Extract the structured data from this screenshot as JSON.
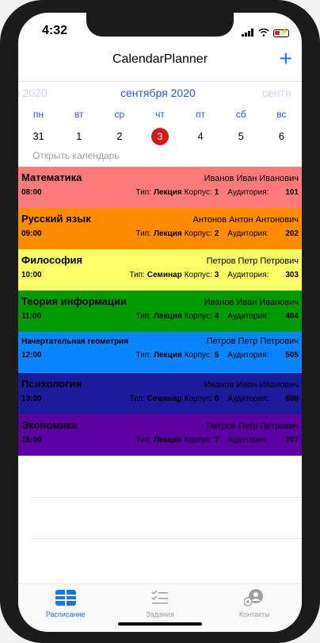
{
  "status_bar": {
    "time": "4:32"
  },
  "navbar": {
    "title": "CalendarPlanner",
    "add_icon": "plus-icon"
  },
  "week": {
    "prev_month": "я 2020",
    "current_month": "сентября 2020",
    "next_month": "сентя",
    "days": [
      {
        "name": "пн",
        "num": "31"
      },
      {
        "name": "вт",
        "num": "1"
      },
      {
        "name": "ср",
        "num": "2"
      },
      {
        "name": "чт",
        "num": "3"
      },
      {
        "name": "пт",
        "num": "4"
      },
      {
        "name": "сб",
        "num": "5"
      },
      {
        "name": "вс",
        "num": "6"
      }
    ]
  },
  "open_calendar": "Открыть календарь",
  "labels": {
    "type": "Тип:",
    "building": "Корпус:",
    "room": "Аудитория:"
  },
  "lessons": [
    {
      "subject": "Математика",
      "teacher": "Иванов Иван Иванович",
      "time": "08:00",
      "type": "Лекция",
      "building": "1",
      "room": "101",
      "color": "#ff7b7b"
    },
    {
      "subject": "Русский язык",
      "teacher": "Антонов Антон Антонович",
      "time": "09:00",
      "type": "Лекция",
      "building": "2",
      "room": "202",
      "color": "#ff8c00"
    },
    {
      "subject": "Философия",
      "teacher": "Петров Петр Петрович",
      "time": "10:00",
      "type": "Семинар",
      "building": "3",
      "room": "303",
      "color": "#ffff66"
    },
    {
      "subject": "Теория информации",
      "teacher": "Иванов Иван Иванович",
      "time": "11:00",
      "type": "Лекция",
      "building": "4",
      "room": "404",
      "color": "#009900"
    },
    {
      "subject": "Начертательная геометрия",
      "teacher": "Петров Петр Петрович",
      "time": "12:00",
      "type": "Лекция",
      "building": "5",
      "room": "505",
      "color": "#0a84ff"
    },
    {
      "subject": "Психология",
      "teacher": "Иванов Иван Иванович",
      "time": "13:00",
      "type": "Семинар",
      "building": "6",
      "room": "606",
      "color": "#1a1a9a"
    },
    {
      "subject": "Экономика",
      "teacher": "Петров Петр Петрович",
      "time": "15:00",
      "type": "Лекция",
      "building": "7",
      "room": "707",
      "color": "#5c00a3"
    }
  ],
  "tabs": [
    {
      "label": "Расписание",
      "icon": "grid-icon",
      "active": true
    },
    {
      "label": "Задания",
      "icon": "checklist-icon",
      "active": false
    },
    {
      "label": "Контакты",
      "icon": "contacts-icon",
      "active": false
    }
  ]
}
